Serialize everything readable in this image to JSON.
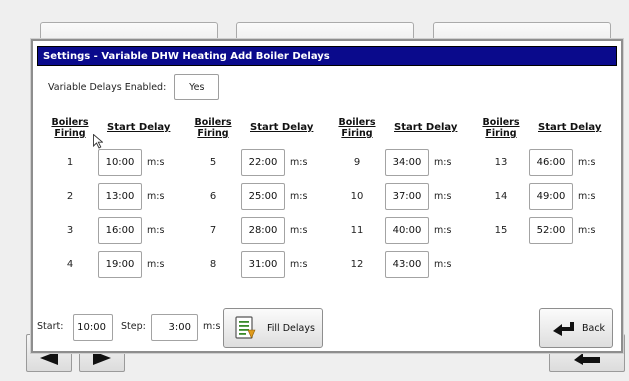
{
  "dialog": {
    "title": "Settings - Variable DHW Heating Add Boiler Delays"
  },
  "enabled": {
    "label": "Variable Delays Enabled:",
    "value": "Yes"
  },
  "headers": {
    "boilers_line1": "Boilers",
    "boilers_line2": "Firing",
    "start_delay": "Start Delay"
  },
  "unit": "m:s",
  "rows": [
    {
      "num": "1",
      "delay": "10:00"
    },
    {
      "num": "2",
      "delay": "13:00"
    },
    {
      "num": "3",
      "delay": "16:00"
    },
    {
      "num": "4",
      "delay": "19:00"
    },
    {
      "num": "5",
      "delay": "22:00"
    },
    {
      "num": "6",
      "delay": "25:00"
    },
    {
      "num": "7",
      "delay": "28:00"
    },
    {
      "num": "8",
      "delay": "31:00"
    },
    {
      "num": "9",
      "delay": "34:00"
    },
    {
      "num": "10",
      "delay": "37:00"
    },
    {
      "num": "11",
      "delay": "40:00"
    },
    {
      "num": "12",
      "delay": "43:00"
    },
    {
      "num": "13",
      "delay": "46:00"
    },
    {
      "num": "14",
      "delay": "49:00"
    },
    {
      "num": "15",
      "delay": "52:00"
    }
  ],
  "bottom": {
    "start_label": "Start:",
    "start_value": "10:00",
    "step_label": "Step:",
    "step_value": "3:00",
    "unit": "m:s",
    "fill_label": "Fill Delays",
    "back_label": "Back"
  }
}
